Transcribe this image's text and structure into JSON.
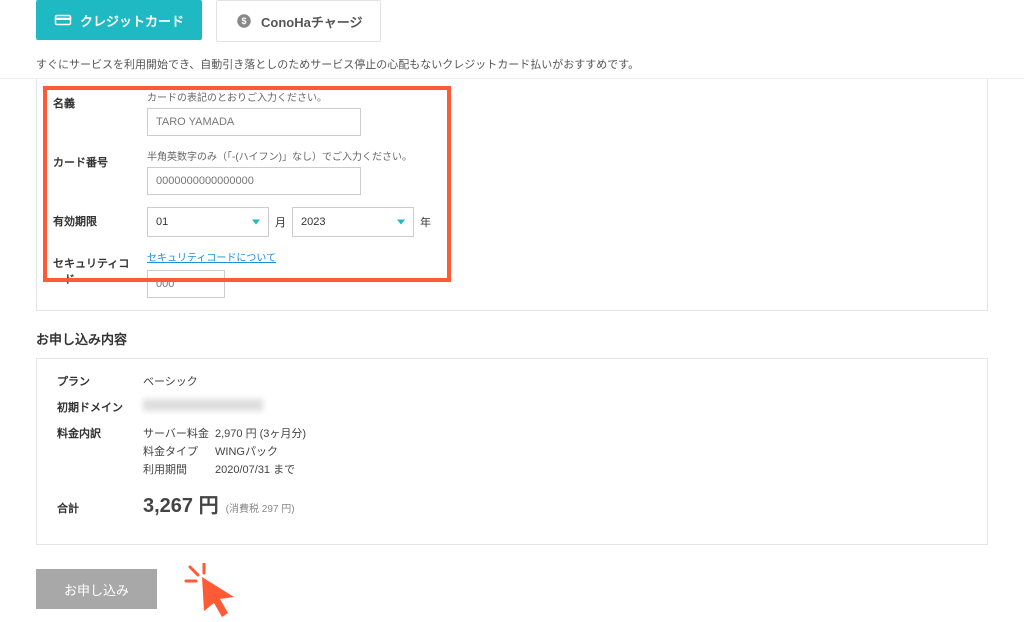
{
  "tabs": {
    "credit": "クレジットカード",
    "charge": "ConoHaチャージ"
  },
  "desc": "すぐにサービスを利用開始でき、自動引き落としのためサービス停止の心配もないクレジットカード払いがおすすめです。",
  "card": {
    "name_label": "名義",
    "name_hint": "カードの表記のとおりご入力ください。",
    "name_value": "TARO YAMADA",
    "number_label": "カード番号",
    "number_hint": "半角英数字のみ（「-(ハイフン)」なし）でご入力ください。",
    "number_placeholder": "0000000000000000",
    "expiry_label": "有効期限",
    "month": "01",
    "month_unit": "月",
    "year": "2023",
    "year_unit": "年",
    "cvc_label": "セキュリティコード",
    "cvc_link": "セキュリティコードについて",
    "cvc_placeholder": "000"
  },
  "order": {
    "section": "お申し込み内容",
    "plan_label": "プラン",
    "plan_value": "ベーシック",
    "domain_label": "初期ドメイン",
    "breakdown_label": "料金内訳",
    "server_fee_label": "サーバー料金",
    "server_fee_value": "2,970 円 (3ヶ月分)",
    "fee_type_label": "料金タイプ",
    "fee_type_value": "WINGパック",
    "period_label": "利用期間",
    "period_value": "2020/07/31 まで",
    "total_label": "合計",
    "total_value": "3,267 円",
    "tax_note": "(消費税 297 円)"
  },
  "submit": "お申し込み"
}
